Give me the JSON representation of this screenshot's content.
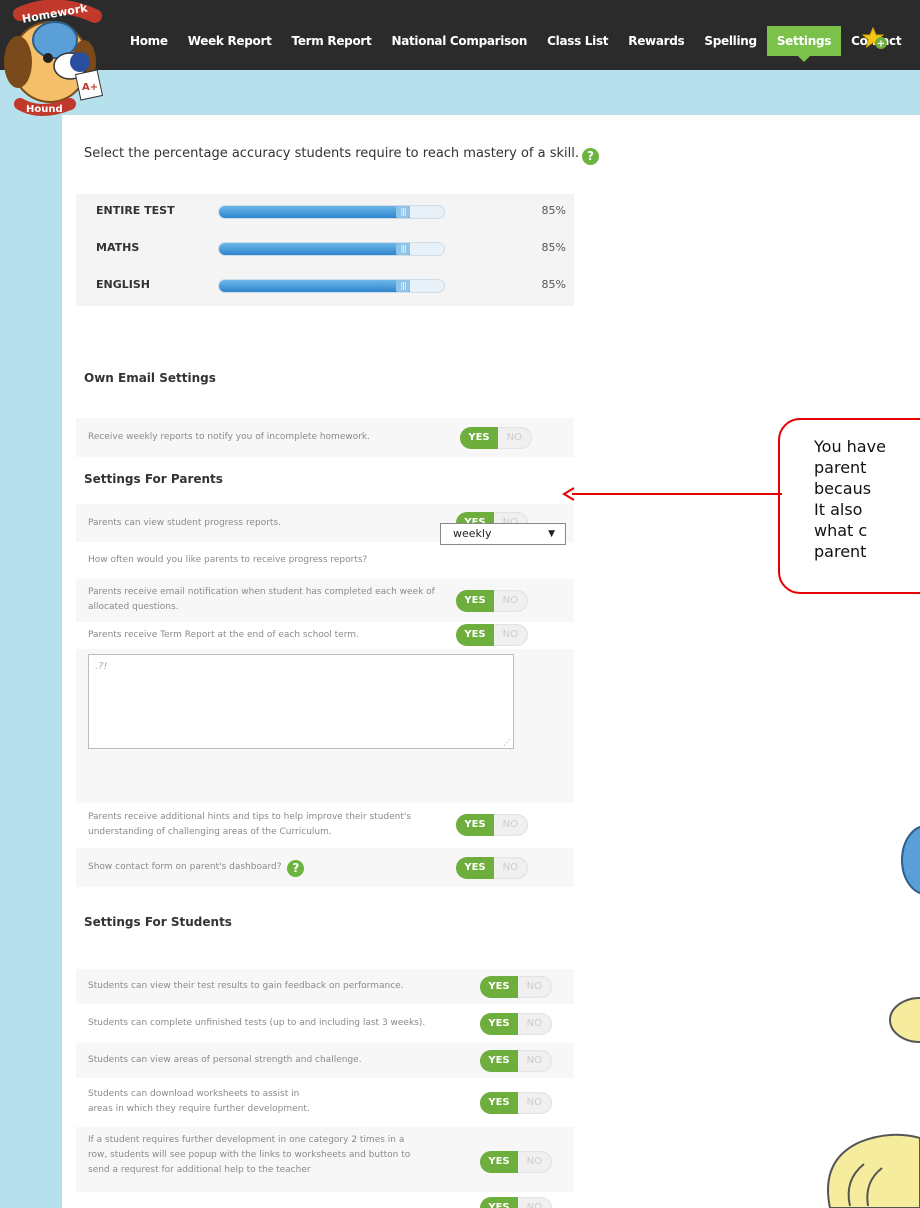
{
  "logo": {
    "top_text": "Homework",
    "bottom_text": "Hound",
    "grade": "A+"
  },
  "nav": {
    "items": [
      "Home",
      "Week Report",
      "Term Report",
      "National Comparison",
      "Class List",
      "Rewards",
      "Spelling",
      "Settings",
      "Contact"
    ],
    "active": "Settings"
  },
  "mastery": {
    "title": "Select the percentage accuracy students require to reach mastery of a skill.",
    "help": "?",
    "rows": [
      {
        "label": "ENTIRE TEST",
        "value": "85%",
        "level": 0.85
      },
      {
        "label": "MATHS",
        "value": "85%",
        "level": 0.85
      },
      {
        "label": "ENGLISH",
        "value": "85%",
        "level": 0.85
      }
    ]
  },
  "own_email": {
    "title": "Own Email Settings",
    "rows": [
      {
        "text": "Receive weekly reports to notify you of incomplete homework.",
        "value": "YES"
      }
    ]
  },
  "parents": {
    "title": "Settings For Parents",
    "progress_reports": "Parents can view student progress reports.",
    "frequency_label": "How often would you like parents to receive progress reports?",
    "frequency_value": "weekly",
    "email_notification": "Parents receive email notification when student has completed each week of allocated questions.",
    "term_report": "Parents receive Term Report at the end of each school term.",
    "textarea_placeholder": ".?!",
    "hints": "Parents receive additional hints and tips to help improve their student's understanding of challenging areas of the Curriculum.",
    "contact_form": "Show contact form on parent's dashboard?"
  },
  "students": {
    "title": "Settings For Students",
    "rows": [
      "Students can view their test results to gain feedback on performance.",
      "Students can complete unfinished tests (up to and including last 3 weeks).",
      "Students can view areas of personal strength and challenge.",
      "Students can download worksheets to assist in areas in which they require further development.",
      "If a student requires further development in one category 2 times in a row, students will see popup with the links to worksheets and button to send a requrest for additional help to the teacher"
    ]
  },
  "toggle": {
    "yes": "YES",
    "no": "NO"
  },
  "callout": {
    "lines": [
      "You have",
      "parent",
      "becaus",
      "It also",
      "what c",
      "parent"
    ]
  },
  "colors": {
    "nav_bg": "#2b2b2b",
    "active": "#7cc24a",
    "toggle_yes": "#6dae3d",
    "page_bg": "#b6e0ec",
    "callout_border": "#e60000"
  }
}
